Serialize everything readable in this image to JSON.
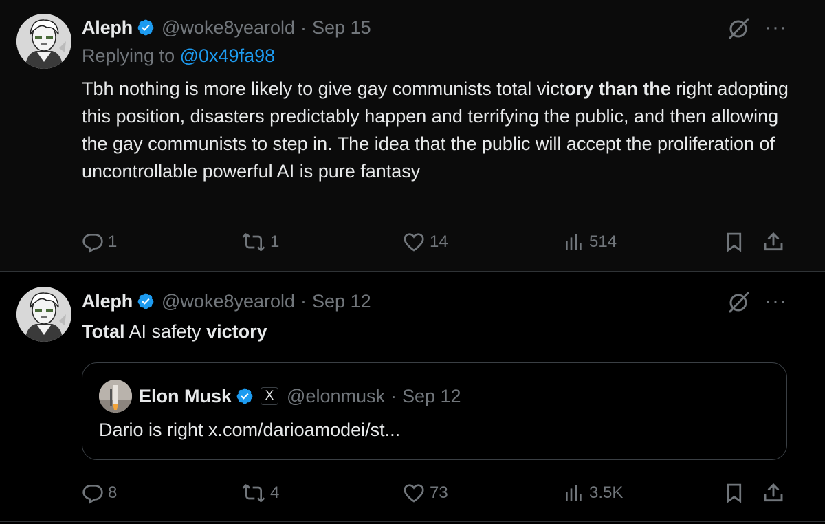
{
  "tweets": [
    {
      "author": {
        "name": "Aleph",
        "handle": "@woke8yearold",
        "avatar": "anime-avatar"
      },
      "date": "Sep 15",
      "replying_to": {
        "prefix": "Replying to",
        "mention": "@0x49fa98"
      },
      "text_segments": [
        {
          "text": "Tbh nothing is more likely to give gay communists total vict",
          "bold": false
        },
        {
          "text": "ory than the",
          "bold": true
        },
        {
          "text": " right adopting this position, disasters predictably happen and terrifying the public, and then allowing the gay communists to step in. The idea that the public will accept the proliferation of uncontrollable powerful AI is pure fantasy",
          "bold": false
        }
      ],
      "actions": {
        "replies": "1",
        "reposts": "1",
        "likes": "14",
        "views": "514"
      },
      "icons": {
        "verified": "verified-badge-icon",
        "grok": "grok-icon",
        "more": "more-icon"
      }
    },
    {
      "author": {
        "name": "Aleph",
        "handle": "@woke8yearold",
        "avatar": "anime-avatar"
      },
      "date": "Sep 12",
      "text_segments": [
        {
          "text": "Total",
          "bold": true
        },
        {
          "text": " AI safety ",
          "bold": false
        },
        {
          "text": "victory",
          "bold": true
        }
      ],
      "quote": {
        "author": {
          "name": "Elon Musk",
          "handle": "@elonmusk",
          "affiliate_badge": "X"
        },
        "date": "Sep 12",
        "text": "Dario is right x.com/darioamodei/st..."
      },
      "actions": {
        "replies": "8",
        "reposts": "4",
        "likes": "73",
        "views": "3.5K"
      }
    }
  ],
  "ui": {
    "separator": "·",
    "more_label": "···"
  },
  "colors": {
    "background": "#000000",
    "text": "#e7e9ea",
    "muted": "#71767b",
    "accent": "#1d9bf0",
    "border": "#2f3336"
  }
}
